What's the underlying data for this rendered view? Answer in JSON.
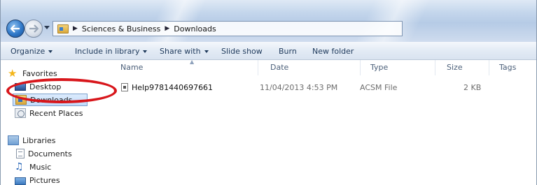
{
  "address": {
    "crumbs": [
      "Sciences & Business",
      "Downloads"
    ]
  },
  "toolbar": {
    "organize": "Organize",
    "include_in_library": "Include in library",
    "share_with": "Share with",
    "slide_show": "Slide show",
    "burn": "Burn",
    "new_folder": "New folder"
  },
  "nav": {
    "favorites": "Favorites",
    "desktop": "Desktop",
    "downloads": "Downloads",
    "recent_places": "Recent Places",
    "libraries": "Libraries",
    "documents": "Documents",
    "music": "Music",
    "pictures": "Pictures",
    "selected": "Downloads"
  },
  "columns": {
    "name": "Name",
    "date": "Date",
    "type": "Type",
    "size": "Size",
    "tags": "Tags"
  },
  "files": [
    {
      "name": "Help9781440697661",
      "date": "11/04/2013 4:53 PM",
      "type": "ACSM File",
      "size": "2 KB",
      "icon": "acsm-file-icon"
    }
  ],
  "colors": {
    "highlight_ring": "#d8161b",
    "selection": "#c1dcfc"
  }
}
